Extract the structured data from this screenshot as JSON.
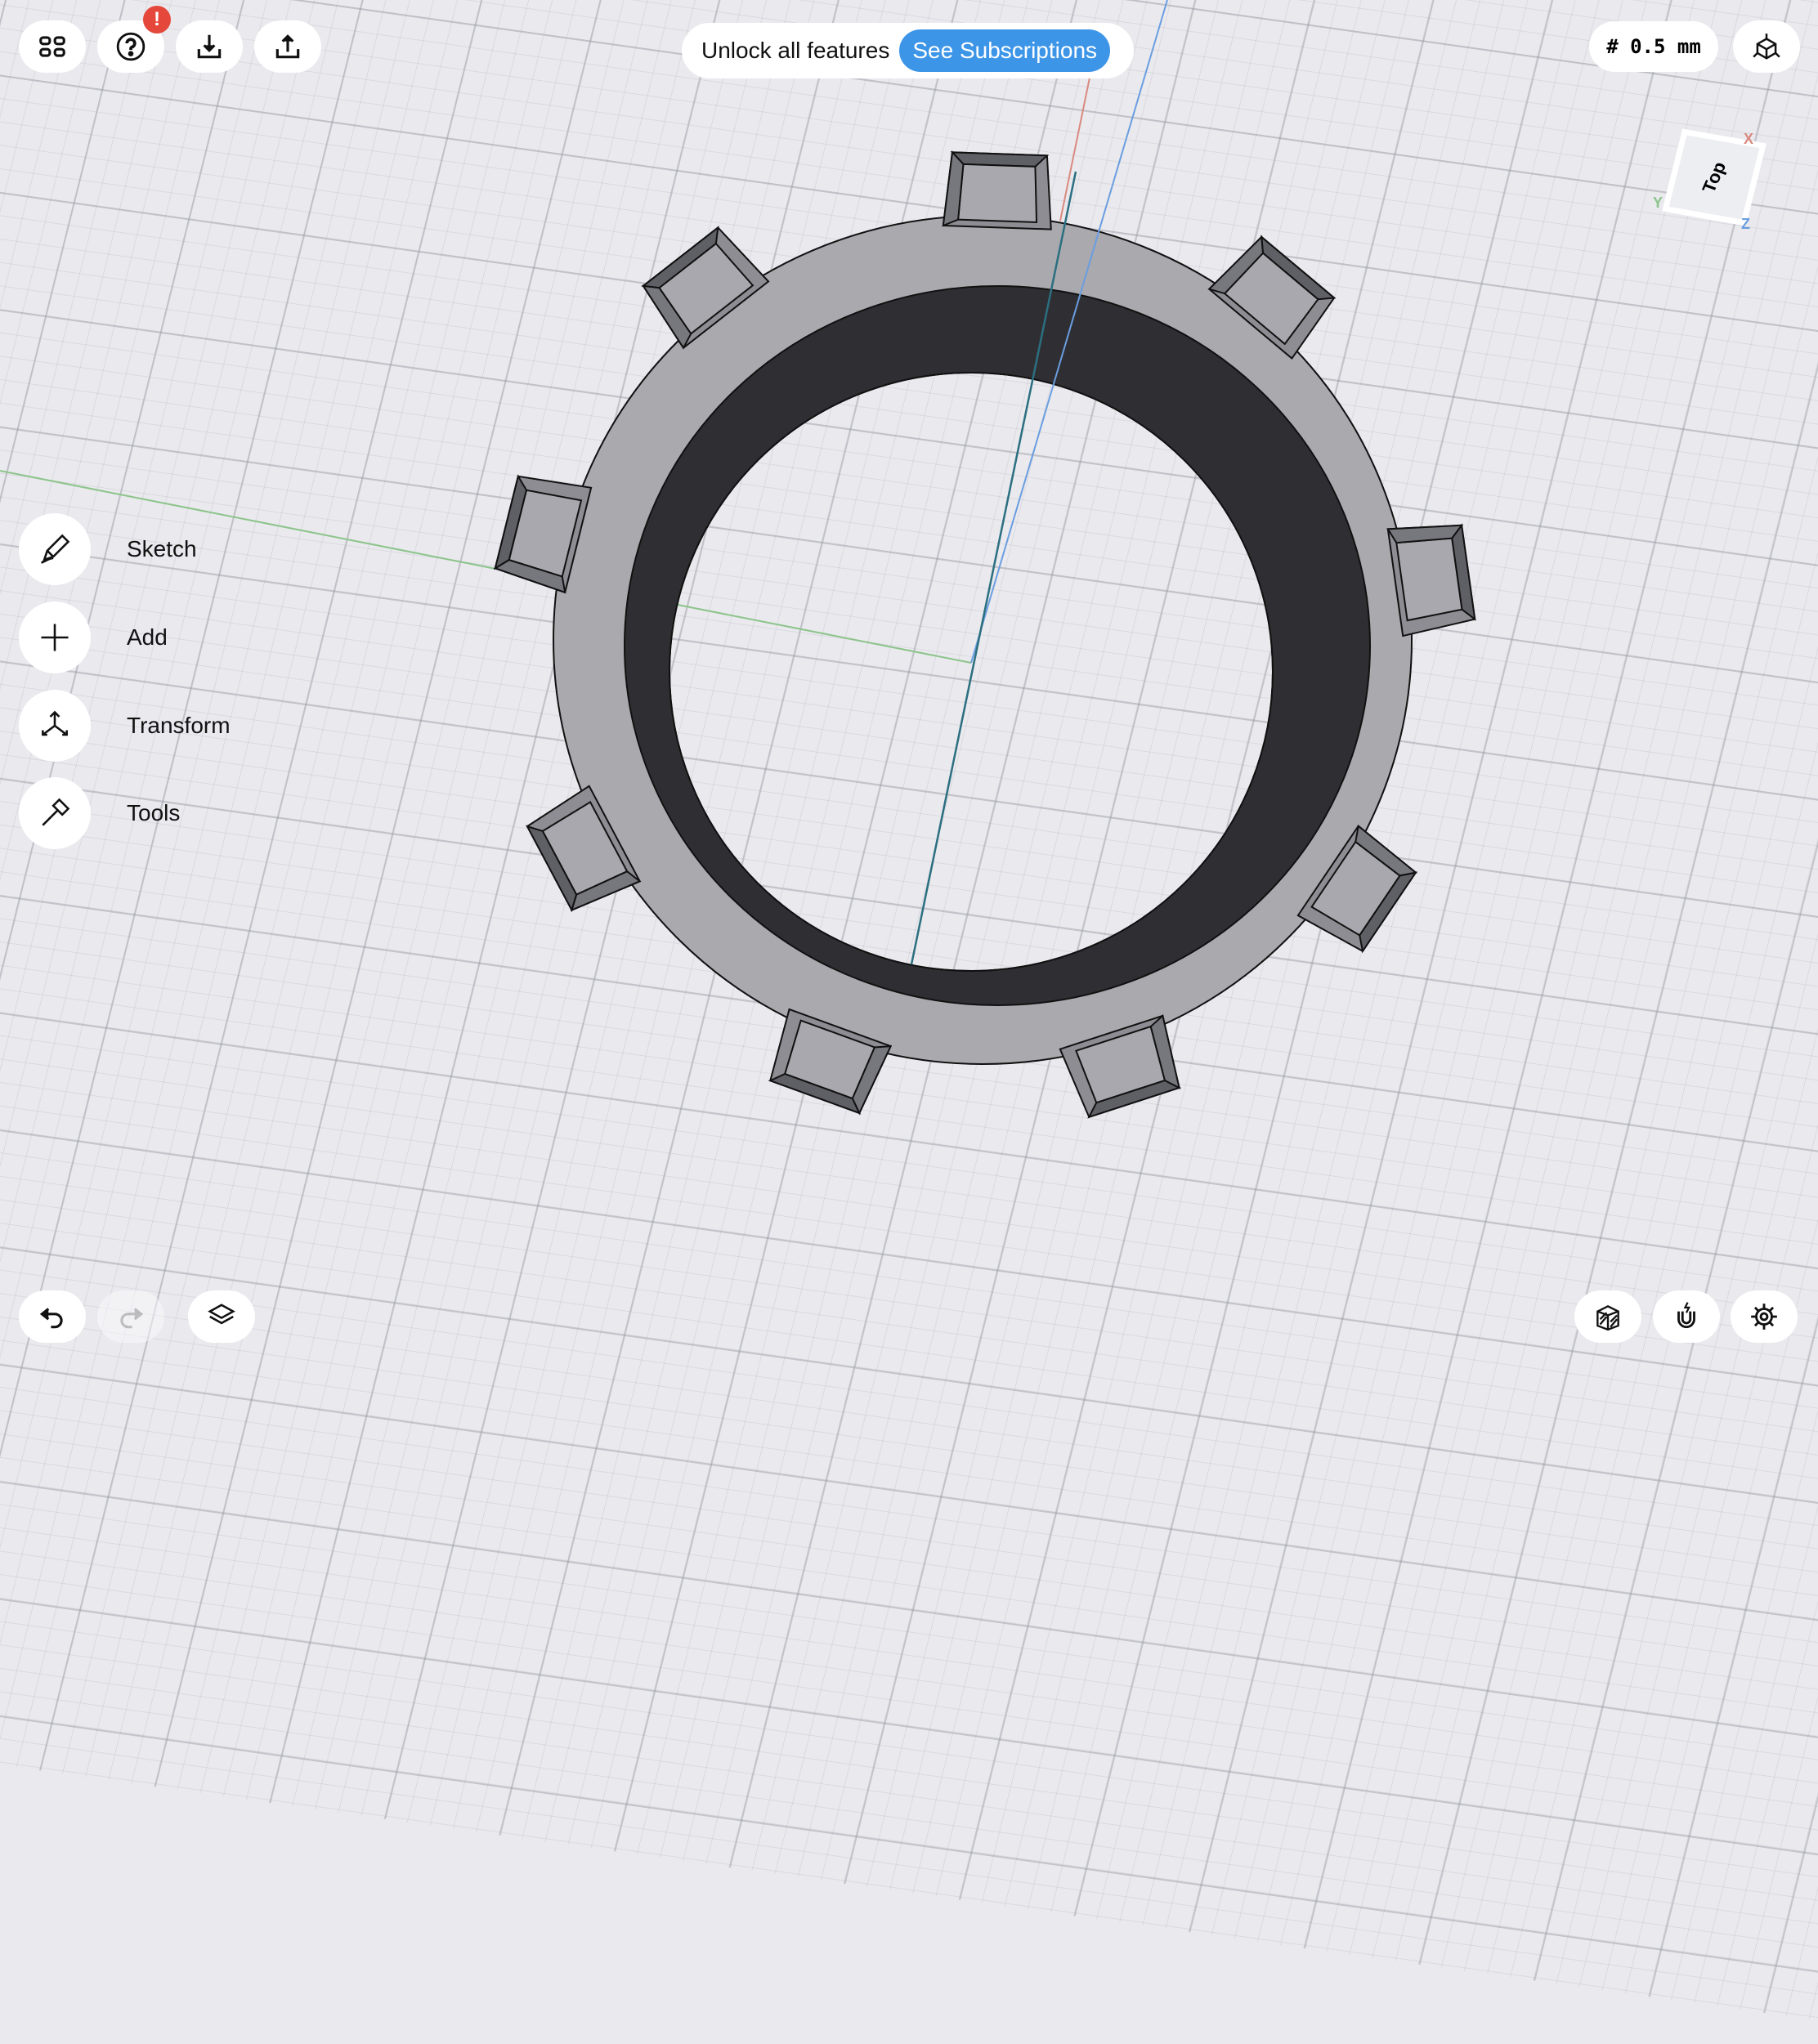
{
  "toolbar_top_left": [
    {
      "name": "grid-view",
      "icon": "grid-icon"
    },
    {
      "name": "help",
      "icon": "question-icon",
      "badge": "!"
    },
    {
      "name": "import",
      "icon": "download-icon"
    },
    {
      "name": "export",
      "icon": "share-icon"
    }
  ],
  "banner": {
    "text": "Unlock all features",
    "button": "See Subscriptions",
    "accent": "#3d95e8"
  },
  "grid_size": "# 0.5 mm",
  "view_cube": {
    "face": "Top",
    "axes": {
      "x": "X",
      "y": "Y",
      "z": "Z"
    }
  },
  "side_menu": [
    {
      "label": "Sketch",
      "icon": "pencil-icon"
    },
    {
      "label": "Add",
      "icon": "plus-icon"
    },
    {
      "label": "Transform",
      "icon": "transform-icon"
    },
    {
      "label": "Tools",
      "icon": "hammer-icon"
    }
  ],
  "bottom_left": [
    {
      "name": "undo",
      "icon": "undo-icon"
    },
    {
      "name": "redo",
      "icon": "redo-icon",
      "disabled": true
    },
    {
      "name": "layers",
      "icon": "layers-icon"
    }
  ],
  "bottom_right": [
    {
      "name": "render-mode",
      "icon": "hatched-cube-icon"
    },
    {
      "name": "snap",
      "icon": "magnet-icon"
    },
    {
      "name": "settings",
      "icon": "gear-icon"
    }
  ]
}
